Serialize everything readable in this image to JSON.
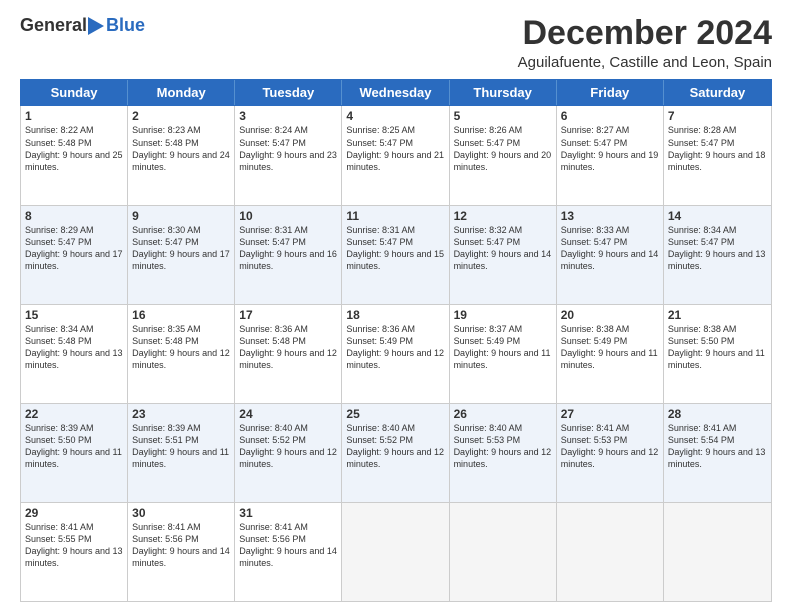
{
  "logo": {
    "general": "General",
    "blue": "Blue"
  },
  "title": "December 2024",
  "location": "Aguilafuente, Castille and Leon, Spain",
  "header_days": [
    "Sunday",
    "Monday",
    "Tuesday",
    "Wednesday",
    "Thursday",
    "Friday",
    "Saturday"
  ],
  "weeks": [
    [
      {
        "day": "1",
        "sunrise": "Sunrise: 8:22 AM",
        "sunset": "Sunset: 5:48 PM",
        "daylight": "Daylight: 9 hours and 25 minutes.",
        "empty": false
      },
      {
        "day": "2",
        "sunrise": "Sunrise: 8:23 AM",
        "sunset": "Sunset: 5:48 PM",
        "daylight": "Daylight: 9 hours and 24 minutes.",
        "empty": false
      },
      {
        "day": "3",
        "sunrise": "Sunrise: 8:24 AM",
        "sunset": "Sunset: 5:47 PM",
        "daylight": "Daylight: 9 hours and 23 minutes.",
        "empty": false
      },
      {
        "day": "4",
        "sunrise": "Sunrise: 8:25 AM",
        "sunset": "Sunset: 5:47 PM",
        "daylight": "Daylight: 9 hours and 21 minutes.",
        "empty": false
      },
      {
        "day": "5",
        "sunrise": "Sunrise: 8:26 AM",
        "sunset": "Sunset: 5:47 PM",
        "daylight": "Daylight: 9 hours and 20 minutes.",
        "empty": false
      },
      {
        "day": "6",
        "sunrise": "Sunrise: 8:27 AM",
        "sunset": "Sunset: 5:47 PM",
        "daylight": "Daylight: 9 hours and 19 minutes.",
        "empty": false
      },
      {
        "day": "7",
        "sunrise": "Sunrise: 8:28 AM",
        "sunset": "Sunset: 5:47 PM",
        "daylight": "Daylight: 9 hours and 18 minutes.",
        "empty": false
      }
    ],
    [
      {
        "day": "8",
        "sunrise": "Sunrise: 8:29 AM",
        "sunset": "Sunset: 5:47 PM",
        "daylight": "Daylight: 9 hours and 17 minutes.",
        "empty": false
      },
      {
        "day": "9",
        "sunrise": "Sunrise: 8:30 AM",
        "sunset": "Sunset: 5:47 PM",
        "daylight": "Daylight: 9 hours and 17 minutes.",
        "empty": false
      },
      {
        "day": "10",
        "sunrise": "Sunrise: 8:31 AM",
        "sunset": "Sunset: 5:47 PM",
        "daylight": "Daylight: 9 hours and 16 minutes.",
        "empty": false
      },
      {
        "day": "11",
        "sunrise": "Sunrise: 8:31 AM",
        "sunset": "Sunset: 5:47 PM",
        "daylight": "Daylight: 9 hours and 15 minutes.",
        "empty": false
      },
      {
        "day": "12",
        "sunrise": "Sunrise: 8:32 AM",
        "sunset": "Sunset: 5:47 PM",
        "daylight": "Daylight: 9 hours and 14 minutes.",
        "empty": false
      },
      {
        "day": "13",
        "sunrise": "Sunrise: 8:33 AM",
        "sunset": "Sunset: 5:47 PM",
        "daylight": "Daylight: 9 hours and 14 minutes.",
        "empty": false
      },
      {
        "day": "14",
        "sunrise": "Sunrise: 8:34 AM",
        "sunset": "Sunset: 5:47 PM",
        "daylight": "Daylight: 9 hours and 13 minutes.",
        "empty": false
      }
    ],
    [
      {
        "day": "15",
        "sunrise": "Sunrise: 8:34 AM",
        "sunset": "Sunset: 5:48 PM",
        "daylight": "Daylight: 9 hours and 13 minutes.",
        "empty": false
      },
      {
        "day": "16",
        "sunrise": "Sunrise: 8:35 AM",
        "sunset": "Sunset: 5:48 PM",
        "daylight": "Daylight: 9 hours and 12 minutes.",
        "empty": false
      },
      {
        "day": "17",
        "sunrise": "Sunrise: 8:36 AM",
        "sunset": "Sunset: 5:48 PM",
        "daylight": "Daylight: 9 hours and 12 minutes.",
        "empty": false
      },
      {
        "day": "18",
        "sunrise": "Sunrise: 8:36 AM",
        "sunset": "Sunset: 5:49 PM",
        "daylight": "Daylight: 9 hours and 12 minutes.",
        "empty": false
      },
      {
        "day": "19",
        "sunrise": "Sunrise: 8:37 AM",
        "sunset": "Sunset: 5:49 PM",
        "daylight": "Daylight: 9 hours and 11 minutes.",
        "empty": false
      },
      {
        "day": "20",
        "sunrise": "Sunrise: 8:38 AM",
        "sunset": "Sunset: 5:49 PM",
        "daylight": "Daylight: 9 hours and 11 minutes.",
        "empty": false
      },
      {
        "day": "21",
        "sunrise": "Sunrise: 8:38 AM",
        "sunset": "Sunset: 5:50 PM",
        "daylight": "Daylight: 9 hours and 11 minutes.",
        "empty": false
      }
    ],
    [
      {
        "day": "22",
        "sunrise": "Sunrise: 8:39 AM",
        "sunset": "Sunset: 5:50 PM",
        "daylight": "Daylight: 9 hours and 11 minutes.",
        "empty": false
      },
      {
        "day": "23",
        "sunrise": "Sunrise: 8:39 AM",
        "sunset": "Sunset: 5:51 PM",
        "daylight": "Daylight: 9 hours and 11 minutes.",
        "empty": false
      },
      {
        "day": "24",
        "sunrise": "Sunrise: 8:40 AM",
        "sunset": "Sunset: 5:52 PM",
        "daylight": "Daylight: 9 hours and 12 minutes.",
        "empty": false
      },
      {
        "day": "25",
        "sunrise": "Sunrise: 8:40 AM",
        "sunset": "Sunset: 5:52 PM",
        "daylight": "Daylight: 9 hours and 12 minutes.",
        "empty": false
      },
      {
        "day": "26",
        "sunrise": "Sunrise: 8:40 AM",
        "sunset": "Sunset: 5:53 PM",
        "daylight": "Daylight: 9 hours and 12 minutes.",
        "empty": false
      },
      {
        "day": "27",
        "sunrise": "Sunrise: 8:41 AM",
        "sunset": "Sunset: 5:53 PM",
        "daylight": "Daylight: 9 hours and 12 minutes.",
        "empty": false
      },
      {
        "day": "28",
        "sunrise": "Sunrise: 8:41 AM",
        "sunset": "Sunset: 5:54 PM",
        "daylight": "Daylight: 9 hours and 13 minutes.",
        "empty": false
      }
    ],
    [
      {
        "day": "29",
        "sunrise": "Sunrise: 8:41 AM",
        "sunset": "Sunset: 5:55 PM",
        "daylight": "Daylight: 9 hours and 13 minutes.",
        "empty": false
      },
      {
        "day": "30",
        "sunrise": "Sunrise: 8:41 AM",
        "sunset": "Sunset: 5:56 PM",
        "daylight": "Daylight: 9 hours and 14 minutes.",
        "empty": false
      },
      {
        "day": "31",
        "sunrise": "Sunrise: 8:41 AM",
        "sunset": "Sunset: 5:56 PM",
        "daylight": "Daylight: 9 hours and 14 minutes.",
        "empty": false
      },
      {
        "day": "",
        "sunrise": "",
        "sunset": "",
        "daylight": "",
        "empty": true
      },
      {
        "day": "",
        "sunrise": "",
        "sunset": "",
        "daylight": "",
        "empty": true
      },
      {
        "day": "",
        "sunrise": "",
        "sunset": "",
        "daylight": "",
        "empty": true
      },
      {
        "day": "",
        "sunrise": "",
        "sunset": "",
        "daylight": "",
        "empty": true
      }
    ]
  ]
}
